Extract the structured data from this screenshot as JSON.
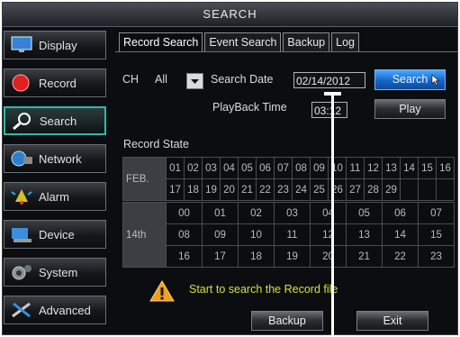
{
  "window_title": "SEARCH",
  "sidebar": {
    "items": [
      {
        "label": "Display",
        "icon": "monitor-icon"
      },
      {
        "label": "Record",
        "icon": "record-icon"
      },
      {
        "label": "Search",
        "icon": "magnifier-icon"
      },
      {
        "label": "Network",
        "icon": "network-icon"
      },
      {
        "label": "Alarm",
        "icon": "alarm-icon"
      },
      {
        "label": "Device",
        "icon": "device-icon"
      },
      {
        "label": "System",
        "icon": "system-icon"
      },
      {
        "label": "Advanced",
        "icon": "tools-icon"
      }
    ],
    "active": "Search"
  },
  "tabs": [
    "Record Search",
    "Event Search",
    "Backup",
    "Log"
  ],
  "active_tab": "Record Search",
  "form": {
    "ch_label": "CH",
    "ch_value": "All",
    "search_date_label": "Search Date",
    "search_date_value": "02/14/2012",
    "search_button": "Search",
    "playback_time_label": "PlayBack Time",
    "playback_time_value": "03:12",
    "play_button": "Play"
  },
  "record_state": {
    "label": "Record State",
    "month_label": "FEB.",
    "days_row1": [
      "01",
      "02",
      "03",
      "04",
      "05",
      "06",
      "07",
      "08",
      "09",
      "10",
      "11",
      "12",
      "13",
      "14",
      "15",
      "16"
    ],
    "days_row2": [
      "17",
      "18",
      "19",
      "20",
      "21",
      "22",
      "23",
      "24",
      "25",
      "26",
      "27",
      "28",
      "29",
      "",
      "",
      ""
    ],
    "day_label": "14th",
    "hours_row1": [
      "00",
      "01",
      "02",
      "03",
      "04",
      "05",
      "06",
      "07"
    ],
    "hours_row2": [
      "08",
      "09",
      "10",
      "11",
      "12",
      "13",
      "14",
      "15"
    ],
    "hours_row3": [
      "16",
      "17",
      "18",
      "19",
      "20",
      "21",
      "22",
      "23"
    ]
  },
  "status_message": "Start to search the Record file",
  "footer": {
    "backup_button": "Backup",
    "exit_button": "Exit"
  },
  "colors": {
    "accent": "#2fb8a8",
    "search_button": "#1566c8",
    "status_text": "#d8e040"
  }
}
